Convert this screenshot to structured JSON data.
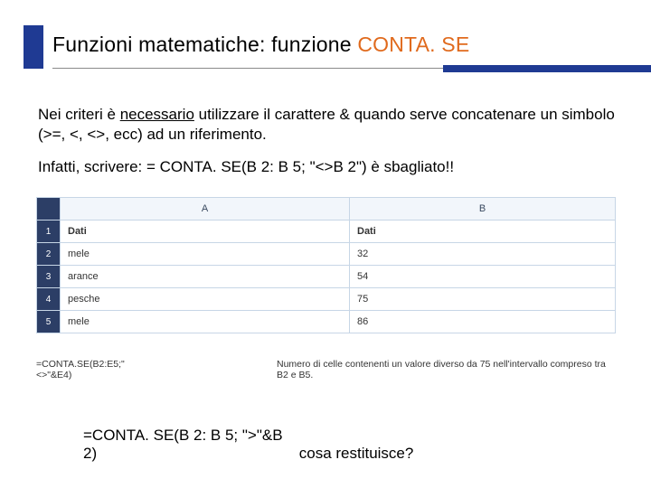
{
  "title": {
    "black": "Funzioni matematiche: funzione ",
    "orange": "CONTA. SE"
  },
  "paragraphs": {
    "p1a": "Nei criteri è ",
    "p1b": "necessario",
    "p1c": " utilizzare il carattere & quando serve concatenare un simbolo (>=, <, <>, ecc)  ad un riferimento.",
    "p2": "Infatti, scrivere: = CONTA. SE(B 2: B 5; \"<>B 2\") è sbagliato!!"
  },
  "sheet": {
    "colA": "A",
    "colB": "B",
    "row1": {
      "n": "1",
      "a": "Dati",
      "b": "Dati"
    },
    "row2": {
      "n": "2",
      "a": "mele",
      "b": "32"
    },
    "row3": {
      "n": "3",
      "a": "arance",
      "b": "54"
    },
    "row4": {
      "n": "4",
      "a": "pesche",
      "b": "75"
    },
    "row5": {
      "n": "5",
      "a": "mele",
      "b": "86"
    }
  },
  "formula_example": {
    "formula": "=CONTA.SE(B2:E5;\"<>\"&E4)",
    "desc": "Numero di celle contenenti un valore diverso da 75 nell'intervallo compreso tra B2 e B5."
  },
  "question": {
    "formula": "=CONTA. SE(B 2: B 5; \">\"&B 2)",
    "prompt": "cosa restituisce?"
  }
}
